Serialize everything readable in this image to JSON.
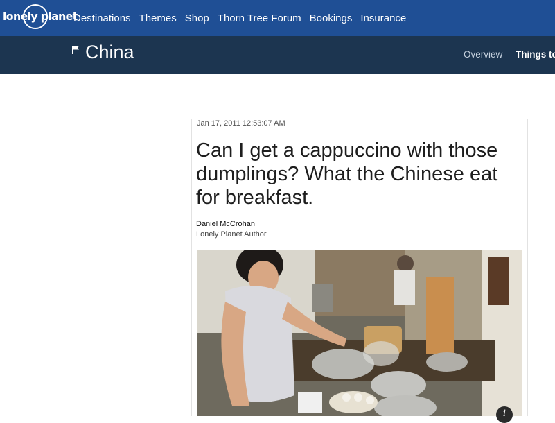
{
  "brand": {
    "logo_text": "lonely planet"
  },
  "nav": {
    "items": [
      {
        "label": "Destinations"
      },
      {
        "label": "Themes"
      },
      {
        "label": "Shop"
      },
      {
        "label": "Thorn Tree Forum"
      },
      {
        "label": "Bookings"
      },
      {
        "label": "Insurance"
      }
    ]
  },
  "section": {
    "icon": "flag-icon",
    "title": "China",
    "subnav": [
      {
        "label": "Overview",
        "active": false
      },
      {
        "label": "Things to",
        "active": true
      }
    ]
  },
  "article": {
    "timestamp": "Jan 17, 2011 12:53:07 AM",
    "headline": "Can I get a cappuccino with those dumplings? What the Chinese eat for breakfast.",
    "author_name": "Daniel McCrohan",
    "author_role": "Lonely Planet Author",
    "photo_info_icon": "info-icon"
  },
  "colors": {
    "topbar": "#1f4f95",
    "subbar": "#1c3550",
    "headline": "#1e1e1e"
  }
}
